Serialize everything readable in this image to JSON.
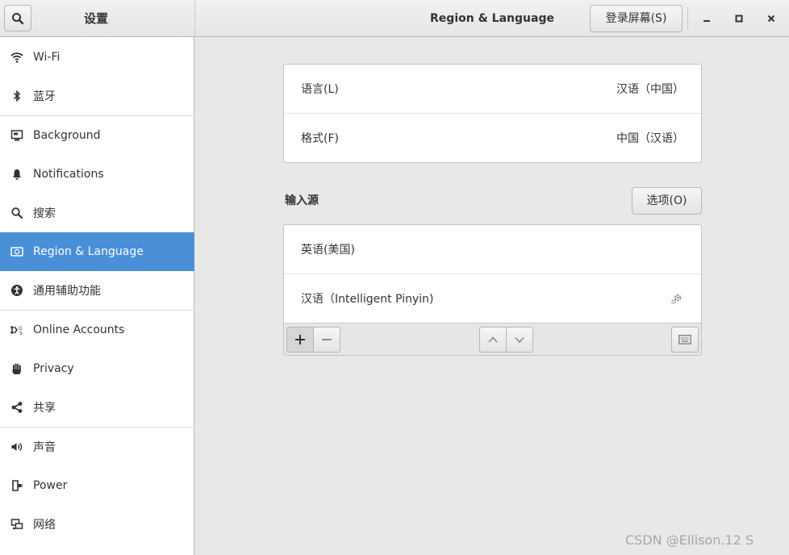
{
  "header": {
    "sidebar_title": "设置",
    "window_title": "Region & Language",
    "login_button": "登录屏幕(S)"
  },
  "sidebar": {
    "items": [
      {
        "label": "Wi-Fi",
        "icon": "wifi-icon"
      },
      {
        "label": "蓝牙",
        "icon": "bluetooth-icon"
      },
      {
        "label": "Background",
        "icon": "background-icon"
      },
      {
        "label": "Notifications",
        "icon": "bell-icon"
      },
      {
        "label": "搜索",
        "icon": "search-icon"
      },
      {
        "label": "Region & Language",
        "icon": "region-icon",
        "active": true
      },
      {
        "label": "通用辅助功能",
        "icon": "accessibility-icon"
      },
      {
        "label": "Online Accounts",
        "icon": "online-accounts-icon"
      },
      {
        "label": "Privacy",
        "icon": "hand-icon"
      },
      {
        "label": "共享",
        "icon": "share-icon"
      },
      {
        "label": "声音",
        "icon": "speaker-icon"
      },
      {
        "label": "Power",
        "icon": "power-icon"
      },
      {
        "label": "网络",
        "icon": "network-icon"
      }
    ]
  },
  "region": {
    "language_label": "语言(L)",
    "language_value": "汉语（中国）",
    "formats_label": "格式(F)",
    "formats_value": "中国（汉语）"
  },
  "input_sources": {
    "title": "输入源",
    "options_button": "选项(O)",
    "sources": [
      {
        "label": "英语(美国)"
      },
      {
        "label": "汉语（Intelligent Pinyin)",
        "has_settings": true
      }
    ]
  },
  "watermark": "CSDN @Ellison.12 S",
  "colors": {
    "accent": "#4a90d9",
    "background": "#e8e8e7"
  }
}
